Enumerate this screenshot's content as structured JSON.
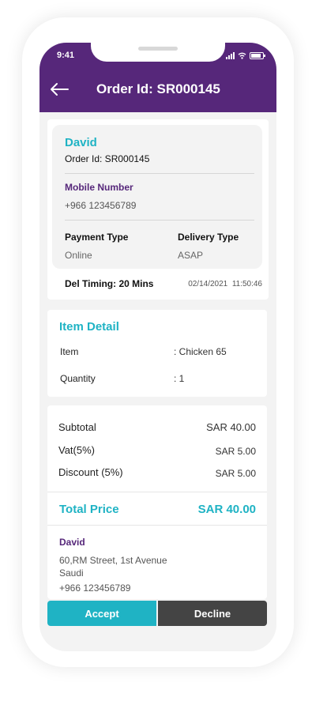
{
  "status_bar": {
    "time": "9:41"
  },
  "header": {
    "title": "Order Id: SR000145"
  },
  "order": {
    "customer_name": "David",
    "order_id_line": "Order Id: SR000145",
    "mobile_label": "Mobile Number",
    "mobile_value": "+966 123456789",
    "payment_type_label": "Payment Type",
    "payment_type_value": "Online",
    "delivery_type_label": "Delivery Type",
    "delivery_type_value": "ASAP",
    "del_timing": "Del Timing: 20 Mins",
    "date": "02/14/2021",
    "time": "11:50:46"
  },
  "item_detail": {
    "title": "Item Detail",
    "rows": [
      {
        "label": "Item",
        "value": ": Chicken 65"
      },
      {
        "label": "Quantity",
        "value": ": 1"
      }
    ]
  },
  "pricing": {
    "subtotal_label": "Subtotal",
    "subtotal_value": "SAR 40.00",
    "vat_label": "Vat(5%)",
    "vat_value": "SAR 5.00",
    "discount_label": "Discount (5%)",
    "discount_value": "SAR 5.00",
    "total_label": "Total Price",
    "total_value": "SAR 40.00"
  },
  "address": {
    "name": "David",
    "line1": "60,RM Street, 1st Avenue",
    "line2": "Saudi",
    "phone": "+966 123456789"
  },
  "actions": {
    "accept": "Accept",
    "decline": "Decline"
  },
  "colors": {
    "primary": "#56277a",
    "accent": "#1fb3c4",
    "decline": "#444444"
  }
}
